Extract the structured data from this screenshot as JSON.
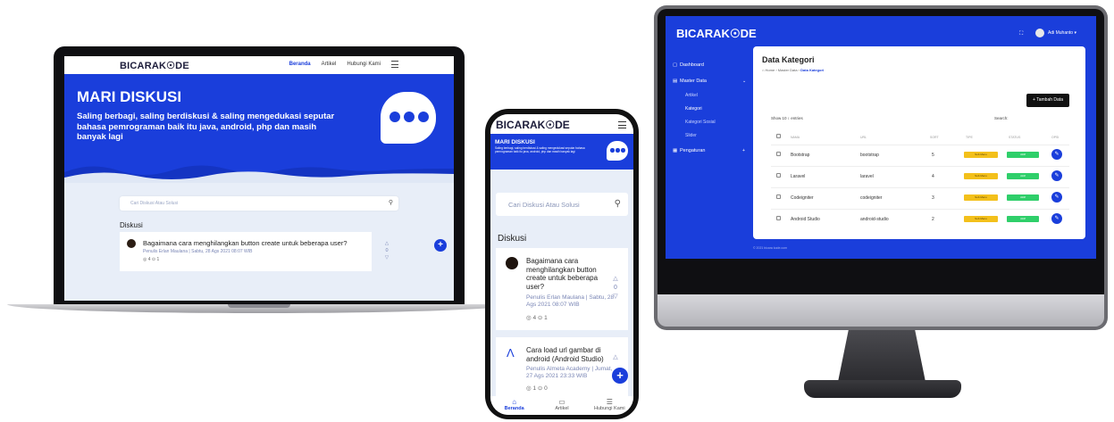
{
  "laptop": {
    "logo": "BICARAK☉DE",
    "nav": {
      "home": "Beranda",
      "article": "Artikel",
      "contact": "Hubungi Kami"
    },
    "hero": {
      "title": "MARI DISKUSI",
      "subtitle": "Saling berbagi, saling berdiskusi & saling mengedukasi seputar bahasa pemrograman baik itu java, android, php dan masih banyak lagi"
    },
    "search_placeholder": "Cari Diskusi Atau Solusi",
    "section_title": "Diskusi",
    "post": {
      "question": "Bagaimana cara menghilangkan button create untuk beberapa user?",
      "meta": "Penulis Erlan Maulana  |  Sabtu, 28 Ags 2021 08:07 WIB",
      "stats": "◎ 4   ⊙ 1",
      "votes": "0"
    },
    "fab": "+"
  },
  "phone": {
    "logo": "BICARAK☉DE",
    "hero": {
      "title": "MARI DISKUSI",
      "subtitle": "Saling berbagi, saling berdiskusi & saling mengedukasi seputar bahasa pemrograman baik itu java, android, php dan masih banyak lagi"
    },
    "search_placeholder": "Cari Diskusi Atau Solusi",
    "section_title": "Diskusi",
    "posts": [
      {
        "question": "Bagaimana cara menghilangkan button create untuk beberapa user?",
        "meta": "Penulis Erlan Maulana  |  Sabtu, 28 Ags 2021 08:07 WIB",
        "stats": "◎ 4   ⊙ 1",
        "votes": "0"
      },
      {
        "question": "Cara load url gambar di android (Android Studio)",
        "meta": "Penulis Almeta Academy  |  Jumat, 27 Ags 2021 23:33 WIB",
        "stats": "◎ 1   ⊙ 0",
        "votes": "0"
      }
    ],
    "tabs": {
      "home": "Beranda",
      "article": "Artikel",
      "contact": "Hubungi Kami"
    },
    "fab": "+"
  },
  "desktop": {
    "logo": "BICARAK☉DE",
    "user_name": "Adi Muhanto ▾",
    "sidebar": {
      "dashboard": "Dashboard",
      "master_data": "Master Data",
      "sub_items": [
        "Artikel",
        "Kategori",
        "Kategori Sosial",
        "Slider"
      ],
      "settings": "Pengaturan"
    },
    "page_title": "Data Kategori",
    "breadcrumb": {
      "home": "⌂ Home",
      "master": "Master Data",
      "current": "Data Kategori"
    },
    "add_button": "+ Tambah Data",
    "show_label": "Show  10  ↕  entries",
    "search_label": "Search:",
    "columns": [
      "NAMA",
      "URL",
      "SORT",
      "TIPE",
      "STATUS",
      "OPSI"
    ],
    "rows": [
      {
        "name": "Bootstrap",
        "url": "bootstrap",
        "sort": "5",
        "type": "Sub Menu",
        "status": "Aktif"
      },
      {
        "name": "Laravel",
        "url": "laravel",
        "sort": "4",
        "type": "Sub Menu",
        "status": "Aktif"
      },
      {
        "name": "Codeigniter",
        "url": "codeigniter",
        "sort": "3",
        "type": "Sub Menu",
        "status": "Aktif"
      },
      {
        "name": "Android Studio",
        "url": "android-studio",
        "sort": "2",
        "type": "Sub Menu",
        "status": "Aktif"
      }
    ],
    "footer": "© 2021 bicara kode.com"
  },
  "colors": {
    "brand_blue": "#1a3edb",
    "yellow": "#f3c01b",
    "green": "#2fcf6a"
  }
}
